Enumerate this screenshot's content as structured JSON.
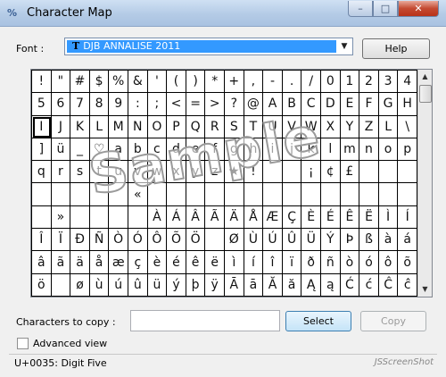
{
  "window": {
    "title": "Character Map",
    "minimize_glyph": "–",
    "maximize_glyph": "□",
    "close_glyph": "✕"
  },
  "font": {
    "label": "Font :",
    "selected": "DJB ANNALISE 2011",
    "icon_glyph": "T"
  },
  "help_label": "Help",
  "grid": {
    "rows": [
      [
        "!",
        "\"",
        "#",
        "$",
        "%",
        "&",
        "'",
        "(",
        ")",
        "*",
        "+",
        ",",
        "-",
        ".",
        "/",
        "0",
        "1",
        "2",
        "3",
        "4"
      ],
      [
        "5",
        "6",
        "7",
        "8",
        "9",
        ":",
        ";",
        "<",
        "=",
        ">",
        "?",
        "@",
        "A",
        "B",
        "C",
        "D",
        "E",
        "F",
        "G",
        "H"
      ],
      [
        "I",
        "J",
        "K",
        "L",
        "M",
        "N",
        "O",
        "P",
        "Q",
        "R",
        "S",
        "T",
        "U",
        "V",
        "W",
        "X",
        "Y",
        "Z",
        "L",
        "\\"
      ],
      [
        "]",
        "ü",
        "_",
        "♡",
        "a",
        "b",
        "c",
        "d",
        "e",
        "f",
        "g",
        "h",
        "i",
        "j",
        "k",
        "l",
        "m",
        "n",
        "o",
        "p"
      ],
      [
        "q",
        "r",
        "s",
        "t",
        "u",
        "v",
        "w",
        "x",
        "y",
        "z",
        "★",
        "!",
        "",
        "",
        "¡",
        "¢",
        "£",
        "",
        "",
        ""
      ],
      [
        "",
        "",
        "",
        "",
        "",
        "«",
        "",
        "",
        "",
        "",
        "",
        "",
        "",
        "",
        "",
        "",
        "",
        "",
        "",
        ""
      ],
      [
        "",
        "»",
        "",
        "",
        "",
        "",
        "À",
        "Á",
        "Â",
        "Ã",
        "Ä",
        "Å",
        "Æ",
        "Ç",
        "È",
        "É",
        "Ê",
        "Ë",
        "Ì",
        "Í"
      ],
      [
        "Î",
        "Ï",
        "Đ",
        "Ñ",
        "Ò",
        "Ó",
        "Ô",
        "Õ",
        "Ö",
        "",
        "Ø",
        "Ù",
        "Ú",
        "Û",
        "Ü",
        "Ý",
        "Þ",
        "ß",
        "à",
        "á"
      ],
      [
        "â",
        "ã",
        "ä",
        "å",
        "æ",
        "ç",
        "è",
        "é",
        "ê",
        "ë",
        "ì",
        "í",
        "î",
        "ï",
        "ð",
        "ñ",
        "ò",
        "ó",
        "ô",
        "õ"
      ],
      [
        "ö",
        "",
        "ø",
        "ù",
        "ú",
        "û",
        "ü",
        "ý",
        "þ",
        "ÿ",
        "Ā",
        "ā",
        "Ă",
        "ă",
        "Ą",
        "ą",
        "Ć",
        "ć",
        "Ĉ",
        "ĉ"
      ]
    ],
    "selected": {
      "row": 2,
      "col": 0
    }
  },
  "watermark": "Sample",
  "copy": {
    "label": "Characters to copy :",
    "value": "",
    "select_label": "Select",
    "copy_label": "Copy"
  },
  "advanced": {
    "label": "Advanced view",
    "checked": false
  },
  "status": {
    "text": "U+0035: Digit Five",
    "site": "JSScreenShot"
  }
}
